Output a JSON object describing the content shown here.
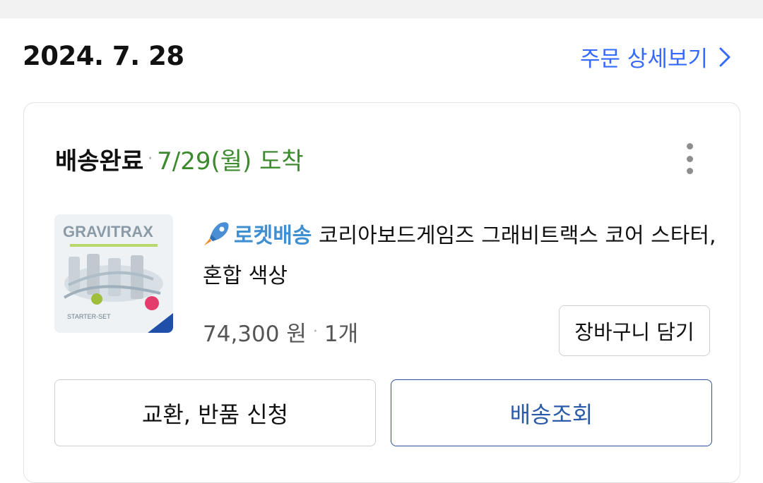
{
  "order": {
    "date": "2024. 7. 28",
    "detail_link_label": "주문 상세보기"
  },
  "shipment": {
    "status": "배송완료",
    "separator": "·",
    "eta": "7/29(월) 도착"
  },
  "product": {
    "badge": "로켓배송",
    "name": "코리아보드게임즈 그래비트랙스 코어 스타터, 혼합 색상",
    "price": "74,300 원",
    "separator": "·",
    "quantity": "1개",
    "thumbnail_logo": "GRAVITRAX",
    "thumbnail_caption": "STARTER-SET"
  },
  "actions": {
    "add_to_cart": "장바구니 담기",
    "return_exchange": "교환, 반품 신청",
    "track_delivery": "배송조회"
  },
  "icons": {
    "more": "more-vertical-icon",
    "chevron": "chevron-right-icon",
    "rocket": "rocket-icon"
  },
  "colors": {
    "link": "#346aff",
    "eta_green": "#3c8a2e",
    "rocket_blue": "#3f8fd2",
    "track_button_border": "#2c4f9e"
  }
}
